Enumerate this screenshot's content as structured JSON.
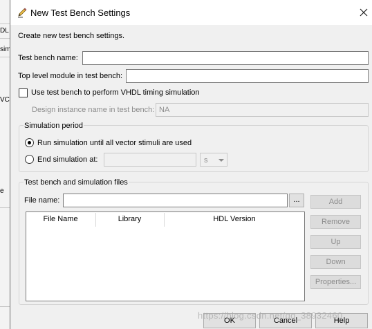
{
  "background": {
    "fragments": [
      "DL",
      "sim",
      "VC",
      "e"
    ]
  },
  "dialog": {
    "title": "New Test Bench Settings",
    "description": "Create new test bench settings.",
    "test_bench_name": {
      "label": "Test bench name:",
      "value": ""
    },
    "top_level_module": {
      "label": "Top level module in test bench:",
      "value": ""
    },
    "vhdl_timing": {
      "label": "Use test bench to perform VHDL timing simulation",
      "checked": false
    },
    "design_instance": {
      "label": "Design instance name in test bench:",
      "value": "NA"
    },
    "simulation_period": {
      "group_label": "Simulation period",
      "run_all": {
        "label": "Run simulation until all vector stimuli are used",
        "selected": true
      },
      "end_at": {
        "label": "End simulation at:",
        "selected": false,
        "value": "",
        "unit": "s"
      }
    },
    "files": {
      "group_label": "Test bench and simulation files",
      "file_name_label": "File name:",
      "file_name_value": "",
      "browse_label": "...",
      "columns": [
        "File Name",
        "Library",
        "HDL Version"
      ],
      "rows": [],
      "buttons": {
        "add": "Add",
        "remove": "Remove",
        "up": "Up",
        "down": "Down",
        "properties": "Properties..."
      }
    },
    "footer": {
      "ok": "OK",
      "cancel": "Cancel",
      "help": "Help"
    },
    "watermark": "https://blog.csdn.net/qq_38932460"
  }
}
